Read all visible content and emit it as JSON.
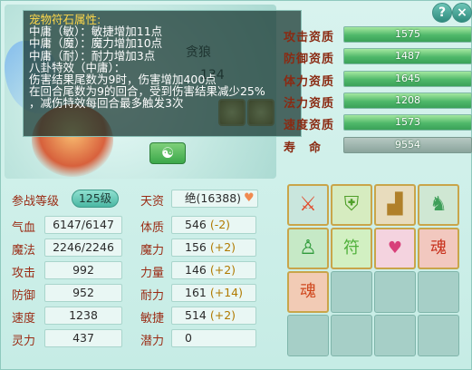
{
  "window": {
    "help_label": "?",
    "close_label": "×"
  },
  "pet": {
    "name": "贪狼",
    "level": "134",
    "yinyang_icon": "☯"
  },
  "tooltip": {
    "title": "宠物符石属性:",
    "lines": [
      "中庸（敏）：敏捷增加11点",
      "中庸（魔）：魔力增加10点",
      "中庸（耐）：耐力增加3点",
      "八卦特效（中庸）：",
      "伤害结果尾数为9时，伤害增加400点",
      "在回合尾数为9的回合，受到伤害结果减少25%",
      "，减伤特效每回合最多触发3次"
    ]
  },
  "aptitudes": [
    {
      "label": "攻击资质",
      "value": "1575"
    },
    {
      "label": "防御资质",
      "value": "1487"
    },
    {
      "label": "体力资质",
      "value": "1645"
    },
    {
      "label": "法力资质",
      "value": "1208"
    },
    {
      "label": "速度资质",
      "value": "1573"
    },
    {
      "label": "寿　命",
      "value": "9554"
    }
  ],
  "stats": {
    "battle_level_label": "参战等级",
    "battle_level_value": "125级",
    "talent_label": "天资",
    "talent_value": "绝(16388)",
    "rows": [
      {
        "l1": "气血",
        "v1": "6147/6147",
        "l2": "体质",
        "v2": "546",
        "b2": "(-2)"
      },
      {
        "l1": "魔法",
        "v1": "2246/2246",
        "l2": "魔力",
        "v2": "156",
        "b2": "(+2)"
      },
      {
        "l1": "攻击",
        "v1": "992",
        "l2": "力量",
        "v2": "146",
        "b2": "(+2)"
      },
      {
        "l1": "防御",
        "v1": "952",
        "l2": "耐力",
        "v2": "161",
        "b2": "(+14)"
      },
      {
        "l1": "速度",
        "v1": "1238",
        "l2": "敏捷",
        "v2": "514",
        "b2": "(+2)"
      },
      {
        "l1": "灵力",
        "v1": "437",
        "l2": "潜力",
        "v2": "0",
        "b2": ""
      }
    ]
  },
  "skills": [
    {
      "name": "skill-1",
      "icon": "warrior-icon",
      "glyph": "⚔",
      "color": "#e24a2a"
    },
    {
      "name": "skill-2",
      "icon": "shield-icon",
      "glyph": "🛡",
      "color": "#6fbf3a"
    },
    {
      "name": "skill-3",
      "icon": "boot-icon",
      "glyph": "👢",
      "color": "#c79a3a"
    },
    {
      "name": "skill-4",
      "icon": "horse-icon",
      "glyph": "♞",
      "color": "#4fb06a"
    },
    {
      "name": "skill-5",
      "icon": "strongman-icon",
      "glyph": "💪",
      "color": "#3aa14a"
    },
    {
      "name": "skill-6",
      "icon": "green-fu-icon",
      "glyph": "符",
      "color": "#6bd04a"
    },
    {
      "name": "skill-7",
      "icon": "heart-fu-icon",
      "glyph": "符",
      "color": "#e25a8a"
    },
    {
      "name": "skill-8",
      "icon": "red-spiral-icon",
      "glyph": "魂",
      "color": "#d83a2a"
    },
    {
      "name": "skill-9",
      "icon": "dragon-icon",
      "glyph": "魂",
      "color": "#d8502a"
    }
  ]
}
